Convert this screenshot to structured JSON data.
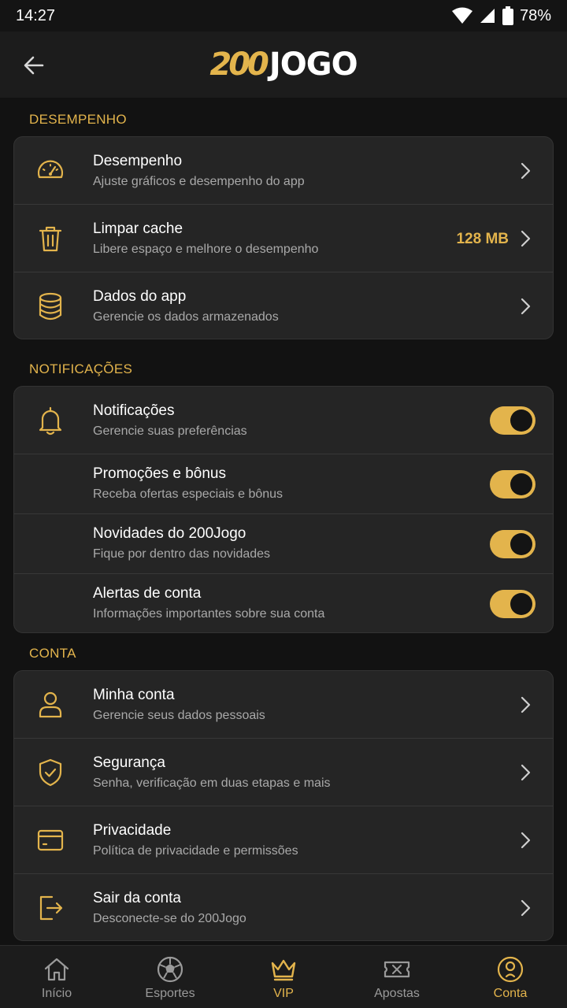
{
  "status_bar": {
    "time": "14:27",
    "battery": "78%"
  },
  "header": {
    "logo_number": "200",
    "logo_word": "JOGO"
  },
  "sections": {
    "performance": {
      "title": "DESEMPENHO",
      "rows": [
        {
          "title": "Desempenho",
          "subtitle": "Ajuste gráficos e desempenho do app",
          "icon": "speedometer-icon"
        },
        {
          "title": "Limpar cache",
          "subtitle": "Libere espaço e melhore o desempenho",
          "value": "128 MB",
          "icon": "trash-icon"
        },
        {
          "title": "Dados do app",
          "subtitle": "Gerencie os dados armazenados",
          "icon": "database-icon"
        }
      ]
    },
    "notifications": {
      "title": "NOTIFICAÇÕES",
      "rows": [
        {
          "title": "Notificações",
          "subtitle": "Gerencie suas preferências",
          "icon": "bell-icon",
          "enabled": true
        },
        {
          "title": "Promoções e bônus",
          "subtitle": "Receba ofertas especiais e bônus",
          "enabled": true
        },
        {
          "title": "Novidades do 200Jogo",
          "subtitle": "Fique por dentro das novidades",
          "enabled": true
        },
        {
          "title": "Alertas de conta",
          "subtitle": "Informações importantes sobre sua conta",
          "enabled": true
        }
      ]
    },
    "account": {
      "title": "CONTA",
      "rows": [
        {
          "title": "Minha conta",
          "subtitle": "Gerencie seus dados pessoais",
          "icon": "user-icon"
        },
        {
          "title": "Segurança",
          "subtitle": "Senha, verificação em duas etapas e mais",
          "icon": "shield-icon"
        },
        {
          "title": "Privacidade",
          "subtitle": "Política de privacidade e permissões",
          "icon": "card-icon"
        },
        {
          "title": "Sair da conta",
          "subtitle": "Desconecte-se do 200Jogo",
          "icon": "logout-icon"
        }
      ]
    }
  },
  "bottom_nav": {
    "items": [
      {
        "label": "Início",
        "icon": "home-icon",
        "active": false
      },
      {
        "label": "Esportes",
        "icon": "soccer-ball-icon",
        "active": false
      },
      {
        "label": "VIP",
        "icon": "crown-icon",
        "active": false
      },
      {
        "label": "Apostas",
        "icon": "ticket-icon",
        "active": false
      },
      {
        "label": "Conta",
        "icon": "account-icon",
        "active": true
      }
    ]
  },
  "colors": {
    "accent": "#e3b44c",
    "background": "#121212",
    "card": "#252525",
    "muted_text": "#a9a9a9"
  }
}
